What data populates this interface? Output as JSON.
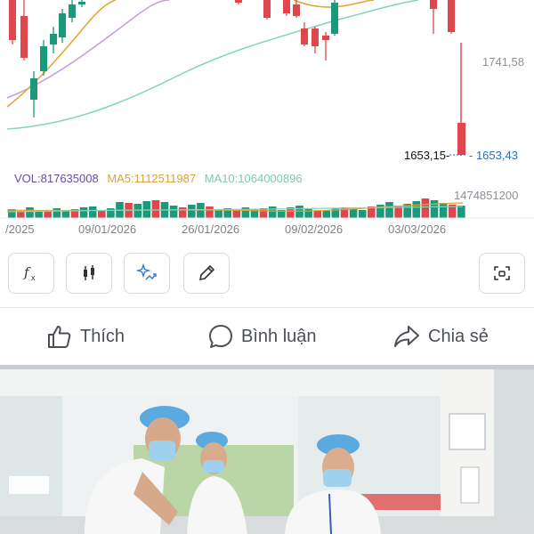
{
  "chart": {
    "price_right_1": "1741,58",
    "price_low_left": "1653,15-",
    "price_current": "- 1653,43",
    "vol_max": "1474851200",
    "vol_label": "VOL:817635008",
    "ma5_label": "MA5:1112511987",
    "ma10_label": "MA10:1064000896",
    "dates": [
      "/2025",
      "09/01/2026",
      "26/01/2026",
      "09/02/2026",
      "03/03/2026"
    ],
    "colors": {
      "up": "#1a9a7b",
      "down": "#e0474c",
      "ma_orange": "#e0a532",
      "ma_purple": "#c39be0",
      "ma_teal": "#7fd3c0",
      "current_price": "#2a6fb5",
      "vol_label": "#6a4aa8",
      "ma5_label": "#d9a23a",
      "ma10_label": "#7cc9b5"
    }
  },
  "toolbar": {
    "buttons": [
      {
        "icon": "function-fx-icon"
      },
      {
        "icon": "candlestick-icon"
      },
      {
        "icon": "sparkle-chart-icon"
      },
      {
        "icon": "pencil-icon"
      },
      {
        "icon": "screenshot-frame-icon"
      }
    ]
  },
  "actions": {
    "like_label": "Thích",
    "comment_label": "Bình luận",
    "share_label": "Chia sẻ"
  }
}
